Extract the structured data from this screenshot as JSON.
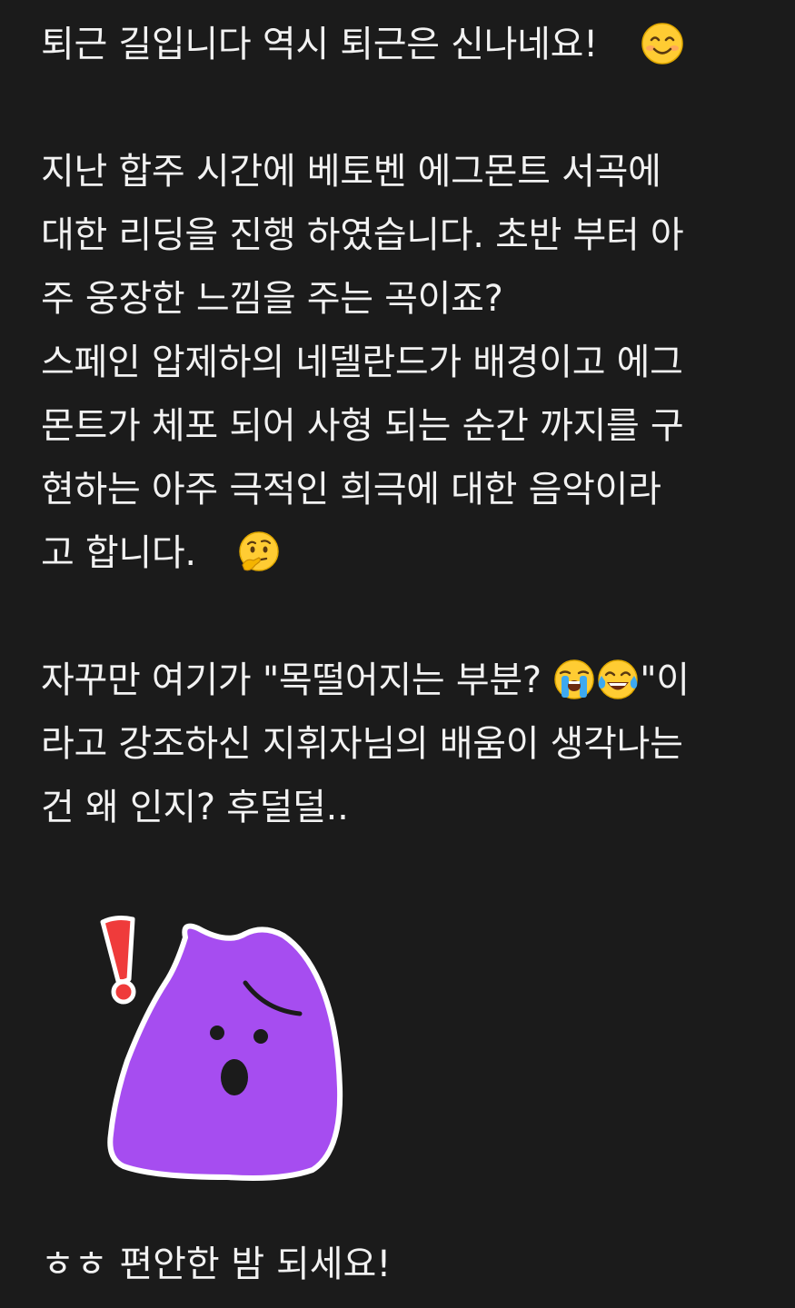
{
  "post": {
    "line1": "퇴근 길입니다  역시 퇴근은 신나네요!",
    "line2": "지난 합주 시간에 베토벤 에그몬트 서곡에",
    "line3": "대한 리딩을 진행 하였습니다. 초반 부터 아",
    "line4": "주 웅장한 느낌을 주는 곡이죠?",
    "line5": "스페인 압제하의 네델란드가 배경이고 에그",
    "line6": "몬트가 체포 되어 사형 되는 순간 까지를 구",
    "line7": "현하는 아주 극적인 희극에 대한 음악이라",
    "line8": "고 합니다.",
    "line9_before": "자꾸만 여기가 \"목떨어지는 부분? ",
    "line9_after": "\"이",
    "line10": "라고 강조하신 지휘자님의 배움이 생각나는",
    "line11": "건 왜 인지?  후덜덜..",
    "last_line": "ㅎㅎ 편안한 밤 되세요!"
  },
  "emoji": {
    "smiling": "smiling-face-emoji",
    "thinking": "thinking-face-emoji",
    "crying": "loudly-crying-face-emoji",
    "tears_of_joy": "face-with-tears-of-joy-emoji"
  },
  "sticker": {
    "name": "purple-blob-surprised-sticker",
    "body_color": "#a64df0",
    "outline_color": "#ffffff",
    "exclamation_color": "#ef3b3b"
  },
  "theme": {
    "background": "#1b1b1b",
    "text": "#f2f2f2"
  }
}
